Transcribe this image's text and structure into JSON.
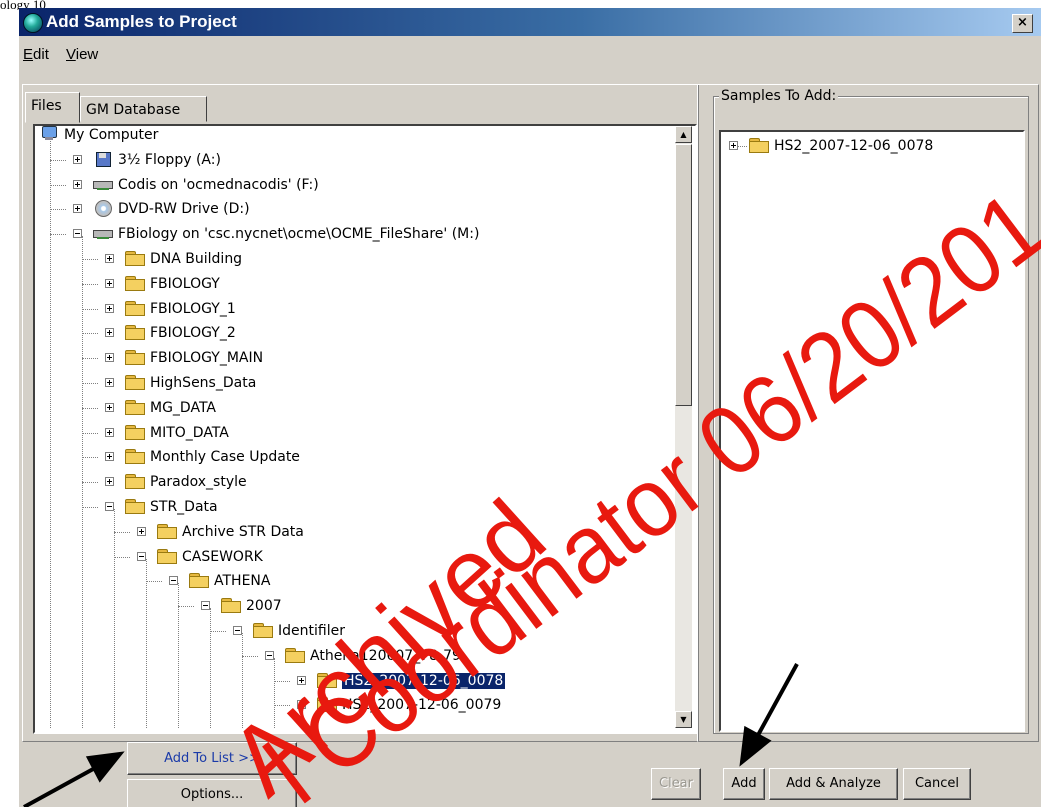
{
  "caption": "ology 10",
  "window": {
    "title": "Add Samples to Project",
    "close_glyph": "×"
  },
  "menu": [
    {
      "label": "Edit",
      "mnemonic": "E",
      "rest": "dit"
    },
    {
      "label": "View",
      "mnemonic": "V",
      "rest": "iew"
    }
  ],
  "tabs": [
    "Files",
    "GM Database"
  ],
  "tree": [
    {
      "label": "My Computer",
      "icon": "computer-icon"
    },
    {
      "label": "3½ Floppy (A:)",
      "icon": "floppy-icon"
    },
    {
      "label": "Codis on 'ocmednacodis' (F:)",
      "icon": "network-drive-icon"
    },
    {
      "label": "DVD-RW Drive (D:)",
      "icon": "dvd-drive-icon"
    },
    {
      "label": "FBiology on 'csc.nycnet\\ocme\\OCME_FileShare' (M:)",
      "icon": "network-drive-icon"
    },
    {
      "label": "DNA Building",
      "icon": "folder-icon"
    },
    {
      "label": "FBIOLOGY",
      "icon": "folder-icon"
    },
    {
      "label": "FBIOLOGY_1",
      "icon": "folder-icon"
    },
    {
      "label": "FBIOLOGY_2",
      "icon": "folder-icon"
    },
    {
      "label": "FBIOLOGY_MAIN",
      "icon": "folder-icon"
    },
    {
      "label": "HighSens_Data",
      "icon": "folder-icon"
    },
    {
      "label": "MG_DATA",
      "icon": "folder-icon"
    },
    {
      "label": "MITO_DATA",
      "icon": "folder-icon"
    },
    {
      "label": "Monthly Case Update",
      "icon": "folder-icon"
    },
    {
      "label": "Paradox_style",
      "icon": "folder-icon"
    },
    {
      "label": "STR_Data",
      "icon": "folder-icon"
    },
    {
      "label": "Archive STR Data",
      "icon": "folder-icon"
    },
    {
      "label": "CASEWORK",
      "icon": "folder-icon"
    },
    {
      "label": "ATHENA",
      "icon": "folder-icon"
    },
    {
      "label": "2007",
      "icon": "folder-icon"
    },
    {
      "label": "Identifiler",
      "icon": "folder-icon"
    },
    {
      "label": "Athena120607_78-79",
      "icon": "folder-icon"
    },
    {
      "label": "HS2_2007-12-06_0078",
      "icon": "folder-icon",
      "selected": true
    },
    {
      "label": "HS2_2007-12-06_0079",
      "icon": "folder-icon"
    }
  ],
  "samples_panel": {
    "label": "Samples To Add:",
    "items": [
      {
        "label": "HS2_2007-12-06_0078",
        "icon": "folder-icon"
      }
    ]
  },
  "buttons": {
    "add_to_list": "Add To List >>",
    "options": "Options...",
    "clear": "Clear",
    "add": "Add",
    "add_analyze": "Add & Analyze",
    "cancel": "Cancel"
  },
  "watermark": {
    "line1": "Archived",
    "line2": "l Coordinator 06/20/201",
    "color": "#e8190f"
  },
  "colors": {
    "titlebar_start": "#0a246a",
    "titlebar_end": "#a6caf0",
    "selection": "#0a246a",
    "face": "#d4d0c8"
  }
}
